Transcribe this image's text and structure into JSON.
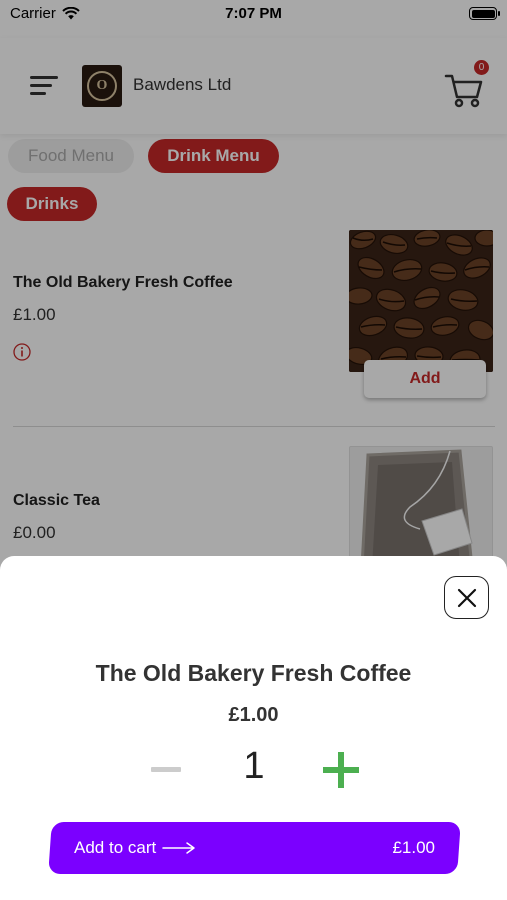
{
  "status_bar": {
    "carrier": "Carrier",
    "time": "7:07 PM"
  },
  "header": {
    "company": "Bawdens Ltd",
    "cart_count": "0",
    "logo_letter": "O"
  },
  "tabs": [
    {
      "label": "Food Menu",
      "active": false
    },
    {
      "label": "Drink Menu",
      "active": true
    }
  ],
  "category": {
    "label": "Drinks"
  },
  "products": [
    {
      "name": "The Old Bakery Fresh Coffee",
      "price": "£1.00",
      "add_label": "Add"
    },
    {
      "name": "Classic Tea",
      "price": "£0.00"
    }
  ],
  "sheet": {
    "title": "The Old Bakery Fresh Coffee",
    "price": "£1.00",
    "quantity": "1",
    "add_to_cart_label": "Add to cart",
    "total": "£1.00"
  },
  "colors": {
    "accent_red": "#c62828",
    "cart_button": "#7b00ff",
    "plus_green": "#4caf50"
  }
}
